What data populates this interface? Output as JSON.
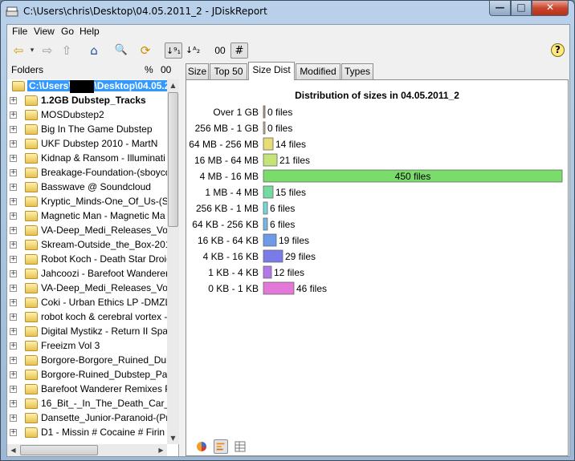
{
  "window": {
    "title": "C:\\Users\\chris\\Desktop\\04.05.2011_2 - JDiskReport",
    "minimize": "—",
    "maximize": "□",
    "close": "✕"
  },
  "menu": {
    "file": "File",
    "view": "View",
    "go": "Go",
    "help": "Help"
  },
  "toolbar": {
    "back": "⇦",
    "forward": "⇨",
    "up": "⇧",
    "home": "⌂",
    "search": "🔍",
    "refresh": "⟳",
    "sort_size": "↓⁹₁",
    "sort_name": "↓ᴬ₂",
    "percent_toggle": "00",
    "count_toggle": "#",
    "help": "?"
  },
  "folders_panel": {
    "label": "Folders",
    "percent_label": "%",
    "count_label": "00",
    "root": "C:\\Users\\chris\\Desktop\\04.05.2011_2",
    "items": [
      "1.2GB Dubstep_Tracks",
      "MOSDubstep2",
      "Big In The Game Dubstep",
      "UKF Dubstep 2010 - MartN",
      "Kidnap & Ransom - Illuminati",
      "Breakage-Foundation-(sboycd",
      "Basswave @ Soundcloud",
      "Kryptic_Minds-One_Of_Us-(SW",
      "Magnetic Man - Magnetic Ma",
      "VA-Deep_Medi_Releases_Volu",
      "Skream-Outside_the_Box-2010",
      "Robot Koch - Death Star Droic",
      "Jahcoozi - Barefoot Wanderer",
      "VA-Deep_Medi_Releases_Volu",
      "Coki - Urban Ethics LP -DMZL",
      "robot koch & cerebral vortex -",
      "Digital Mystikz - Return II Spac",
      "Freeizm Vol 3",
      "Borgore-Borgore_Ruined_Dub",
      "Borgore-Ruined_Dubstep_Part",
      "Barefoot Wanderer Remixes Pa",
      "16_Bit_-_In_The_Death_Car_EP",
      "Dansette_Junior-Paranoid-(Pre",
      "D1 - Missin # Cocaine # Firin E"
    ]
  },
  "tabs": [
    "Size",
    "Top 50",
    "Size Dist",
    "Modified",
    "Types"
  ],
  "active_tab": "Size Dist",
  "chart_data": {
    "type": "bar",
    "orientation": "horizontal",
    "title": "Distribution of sizes in 04.05.2011_2",
    "categories": [
      "Over 1 GB",
      "256 MB - 1 GB",
      "64 MB - 256 MB",
      "16 MB - 64 MB",
      "4 MB - 16 MB",
      "1 MB - 4 MB",
      "256 KB - 1 MB",
      "64 KB - 256 KB",
      "16 KB - 64 KB",
      "4 KB - 16 KB",
      "1 KB - 4 KB",
      "0 KB - 1 KB"
    ],
    "values": [
      0,
      0,
      14,
      21,
      450,
      15,
      6,
      6,
      19,
      29,
      12,
      46
    ],
    "labels": [
      "0 files",
      "0 files",
      "14 files",
      "21 files",
      "450 files",
      "15 files",
      "6 files",
      "6 files",
      "19 files",
      "29 files",
      "12 files",
      "46 files"
    ],
    "colors": [
      "#b09a7a",
      "#c9b28a",
      "#e8dc78",
      "#c4e478",
      "#7adc6a",
      "#74dca0",
      "#74d8d8",
      "#74b8e8",
      "#6e9ae8",
      "#7a7ae8",
      "#b278e8",
      "#e478d8"
    ],
    "xlim": [
      0,
      450
    ]
  }
}
